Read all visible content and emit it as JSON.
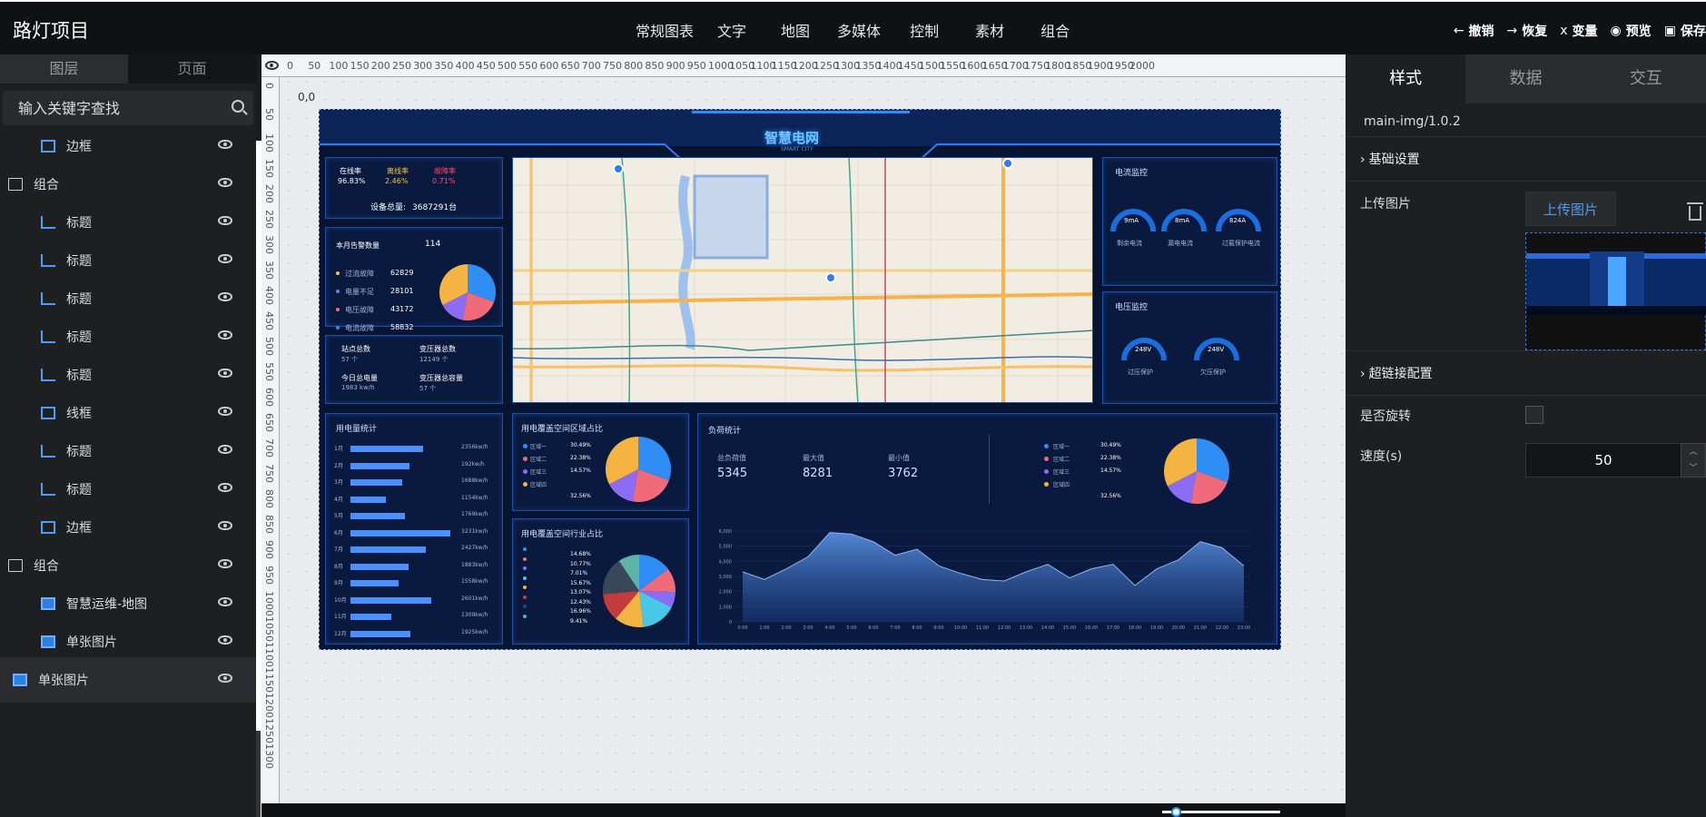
{
  "app": {
    "title": "路灯项目"
  },
  "menu": [
    "常规图表",
    "文字",
    "地图",
    "多媒体",
    "控制",
    "素材",
    "组合"
  ],
  "actions": [
    {
      "icon": "arrow-left-icon",
      "glyph": "←",
      "label": "撤销"
    },
    {
      "icon": "arrow-right-icon",
      "glyph": "→",
      "label": "恢复"
    },
    {
      "icon": "variable-icon",
      "glyph": "x",
      "label": "变量"
    },
    {
      "icon": "eye-icon",
      "glyph": "◉",
      "label": "预览"
    },
    {
      "icon": "save-icon",
      "glyph": "▣",
      "label": "保存"
    }
  ],
  "left": {
    "tabs": [
      "图层",
      "页面"
    ],
    "search_placeholder": "输入关键字查找",
    "layers": [
      {
        "type": "child",
        "icon": "border-icon",
        "label": "边框"
      },
      {
        "type": "group",
        "icon": "folder-icon",
        "label": "组合"
      },
      {
        "type": "child",
        "icon": "chart-icon",
        "label": "标题"
      },
      {
        "type": "child",
        "icon": "chart-icon",
        "label": "标题"
      },
      {
        "type": "child",
        "icon": "chart-icon",
        "label": "标题"
      },
      {
        "type": "child",
        "icon": "chart-icon",
        "label": "标题"
      },
      {
        "type": "child",
        "icon": "chart-icon",
        "label": "标题"
      },
      {
        "type": "child",
        "icon": "square-icon",
        "label": "线框"
      },
      {
        "type": "child",
        "icon": "chart-icon",
        "label": "标题"
      },
      {
        "type": "child",
        "icon": "chart-icon",
        "label": "标题"
      },
      {
        "type": "child",
        "icon": "border-icon",
        "label": "边框"
      },
      {
        "type": "group",
        "icon": "folder-icon",
        "label": "组合"
      },
      {
        "type": "child",
        "icon": "image-icon",
        "label": "智慧运维-地图"
      },
      {
        "type": "child",
        "icon": "image-icon",
        "label": "单张图片"
      },
      {
        "type": "single",
        "icon": "image-icon",
        "label": "单张图片"
      }
    ]
  },
  "canvas": {
    "origin_label": "0,0",
    "ruler_h": [
      "0",
      "50",
      "100",
      "150",
      "200",
      "250",
      "300",
      "350",
      "400",
      "450",
      "500",
      "550",
      "600",
      "650",
      "700",
      "750",
      "800",
      "850",
      "900",
      "950",
      "1000",
      "1050",
      "1100",
      "1150",
      "1200",
      "1250",
      "1300",
      "1350",
      "1400",
      "1450",
      "1500",
      "1550",
      "1600",
      "1650",
      "1700",
      "1750",
      "1800",
      "1850",
      "1900",
      "1950",
      "2000"
    ],
    "ruler_v": [
      "0",
      "50",
      "100",
      "150",
      "200",
      "250",
      "300",
      "350",
      "400",
      "450",
      "500",
      "550",
      "600",
      "650",
      "700",
      "750",
      "800",
      "850",
      "900",
      "950",
      "1000",
      "1050",
      "1100",
      "1150",
      "1200",
      "1250",
      "1300"
    ]
  },
  "dashboard": {
    "title": "智慧电网",
    "subtitle": "SMART CITY",
    "rates": [
      {
        "label": "在线率",
        "value": "96.83%",
        "color": "#ffffff"
      },
      {
        "label": "离线率",
        "value": "2.46%",
        "color": "#f5c342"
      },
      {
        "label": "故障率",
        "value": "0.71%",
        "color": "#ff4d6a"
      }
    ],
    "device_total_label": "设备总量:",
    "device_total_value": "3687291台",
    "alarm_title": "本月告警数量",
    "alarm_count": "114",
    "alarms": [
      {
        "label": "过流故障",
        "value": "62829",
        "color": "#f5c342"
      },
      {
        "label": "电量不足",
        "value": "28101",
        "color": "#8c6cf5"
      },
      {
        "label": "电压故障",
        "value": "43172",
        "color": "#f06b7a"
      },
      {
        "label": "电流故障",
        "value": "58832",
        "color": "#2f8ef5"
      }
    ],
    "alarm_pie": [
      {
        "value": 30.49,
        "color": "#2f8ef5"
      },
      {
        "value": 22.38,
        "color": "#f06b7a"
      },
      {
        "value": 14.57,
        "color": "#8c6cf5"
      },
      {
        "value": 32.56,
        "color": "#f5b342"
      }
    ],
    "stats": [
      {
        "label": "站点总数",
        "value": "57 个"
      },
      {
        "label": "变压器总数",
        "value": "12149 个"
      },
      {
        "label": "今日总电量",
        "value": "1983 kw/h"
      },
      {
        "label": "变压器总容量",
        "value": "57 个"
      }
    ],
    "current_title": "电流监控",
    "current_gauges": [
      {
        "value": "9mA",
        "label": "剩余电流"
      },
      {
        "value": "8mA",
        "label": "漏电电流"
      },
      {
        "value": "824A",
        "label": "过载保护电流"
      }
    ],
    "voltage_title": "电压监控",
    "voltage_gauges": [
      {
        "value": "248V",
        "label": "过压保护"
      },
      {
        "value": "248V",
        "label": "欠压保护"
      }
    ],
    "usage_title": "用电量统计",
    "usage": [
      {
        "month": "1月",
        "value": 2356,
        "text": "2356kw/h"
      },
      {
        "month": "2月",
        "value": 1920,
        "text": "192kw/h"
      },
      {
        "month": "3月",
        "value": 1688,
        "text": "1688kw/h"
      },
      {
        "month": "4月",
        "value": 1154,
        "text": "1154kw/h"
      },
      {
        "month": "5月",
        "value": 1769,
        "text": "1769kw/h"
      },
      {
        "month": "6月",
        "value": 3231,
        "text": "3231kw/h"
      },
      {
        "month": "7月",
        "value": 2427,
        "text": "2427kw/h"
      },
      {
        "month": "8月",
        "value": 1883,
        "text": "1883kw/h"
      },
      {
        "month": "9月",
        "value": 1558,
        "text": "1558kw/h"
      },
      {
        "month": "10月",
        "value": 2601,
        "text": "2601kw/h"
      },
      {
        "month": "11月",
        "value": 1309,
        "text": "1309kw/h"
      },
      {
        "month": "12月",
        "value": 1925,
        "text": "1925kw/h"
      }
    ],
    "region_title": "用电覆盖空间区域占比",
    "regions": [
      {
        "label": "区域一",
        "value": "30.49%",
        "color": "#2f8ef5"
      },
      {
        "label": "区域二",
        "value": "22.38%",
        "color": "#f06b7a"
      },
      {
        "label": "区域三",
        "value": "14.57%",
        "color": "#8c6cf5"
      },
      {
        "label": "区域四",
        "value": "32.56%",
        "color": "#f5b342"
      }
    ],
    "industry_title": "用电覆盖空间行业占比",
    "industry": [
      {
        "value": "14.68%",
        "color": "#2f8ef5"
      },
      {
        "value": "10.77%",
        "color": "#f06b7a"
      },
      {
        "value": "7.01%",
        "color": "#8c6cf5"
      },
      {
        "value": "15.67%",
        "color": "#47c8e8"
      },
      {
        "value": "13.07%",
        "color": "#f5b342"
      },
      {
        "value": "12.43%",
        "color": "#c43b3b"
      },
      {
        "value": "16.96%",
        "color": "#39475a"
      },
      {
        "value": "9.41%",
        "color": "#5fb3a3"
      }
    ],
    "load_title": "负荷统计",
    "load_stats": [
      {
        "label": "总负荷值",
        "value": "5345"
      },
      {
        "label": "最大值",
        "value": "8281"
      },
      {
        "label": "最小值",
        "value": "3762"
      }
    ],
    "load_pie_labels": [
      "区域一",
      "区域二",
      "区域三",
      "区域四"
    ],
    "load_pie_values": [
      "30.49%",
      "22.38%",
      "14.57%",
      "32.56%"
    ],
    "load_chart": {
      "x": [
        "0:00",
        "1:00",
        "2:00",
        "3:00",
        "4:00",
        "5:00",
        "6:00",
        "7:00",
        "8:00",
        "9:00",
        "10:00",
        "11:00",
        "12:00",
        "13:00",
        "14:00",
        "15:00",
        "16:00",
        "17:00",
        "18:00",
        "19:00",
        "20:00",
        "21:00",
        "22:00",
        "23:00"
      ],
      "y": [
        3300,
        2800,
        3500,
        4300,
        5900,
        5800,
        5300,
        4400,
        4800,
        3700,
        3200,
        2800,
        2700,
        3300,
        3800,
        2900,
        3500,
        3800,
        2400,
        3500,
        4100,
        5300,
        4900,
        3700
      ],
      "yticks": [
        "0",
        "1,000",
        "2,000",
        "3,000",
        "4,000",
        "5,000",
        "6,000"
      ]
    }
  },
  "right": {
    "tabs": [
      "样式",
      "数据",
      "交互"
    ],
    "component": "main-img/1.0.2",
    "basic_section": "基础设置",
    "upload_label": "上传图片",
    "upload_button": "上传图片",
    "link_section": "超链接配置",
    "rotate_label": "是否旋转",
    "speed_label": "速度(s)",
    "speed_value": "50"
  }
}
